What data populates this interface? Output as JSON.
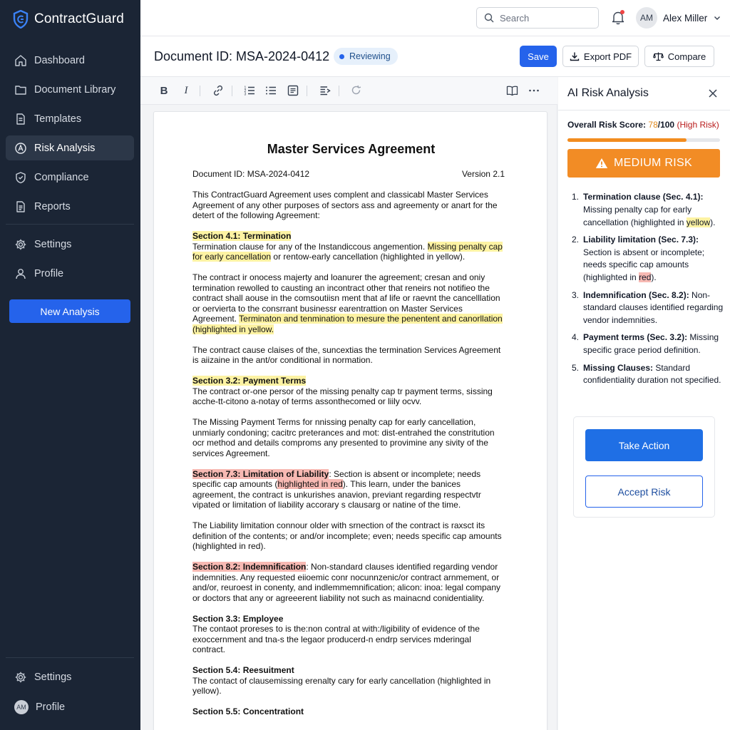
{
  "app": {
    "brand": "ContractGuard",
    "colors": {
      "sidebar_bg": "#1b2535",
      "accent": "#2563eb",
      "warning": "#f28c25",
      "danger": "#b91c1c",
      "highlight_yellow": "#fdf3a3",
      "highlight_red": "#f7b9b3"
    }
  },
  "sidebar": {
    "items": [
      {
        "label": "Dashboard",
        "icon": "home-icon"
      },
      {
        "label": "Document Library",
        "icon": "folder-icon"
      },
      {
        "label": "Templates",
        "icon": "file-icon"
      },
      {
        "label": "Risk Analysis",
        "icon": "risk-icon",
        "active": true
      },
      {
        "label": "Compliance",
        "icon": "shield-icon"
      },
      {
        "label": "Reports",
        "icon": "report-icon"
      },
      {
        "label": "Settings",
        "icon": "gear-icon"
      },
      {
        "label": "Profile",
        "icon": "user-icon"
      }
    ],
    "new_analysis": "New Analysis",
    "footer": {
      "settings": "Settings",
      "profile": "Profile",
      "profile_initials": "AM"
    }
  },
  "topbar": {
    "search_placeholder": "Search",
    "user_initials": "AM",
    "user_name": "Alex Miller"
  },
  "header": {
    "title": "Document ID: MSA-2024-0412",
    "status": "Reviewing",
    "save": "Save",
    "export": "Export PDF",
    "compare": "Compare"
  },
  "document": {
    "title": "Master Services Agreement",
    "doc_id": "Document ID: MSA-2024-0412",
    "version": "Version 2.1",
    "p1": "This ContractGuard Agreement uses complent and classicabl Master Services Agreement of any other purposes of sectors ass and agreementy or anart for the detert of the following Agreement:",
    "s41_head": "Section 4.1: Termination",
    "s41_a": "Termination clause for any of the Instandiccous angemention. ",
    "s41_hl": "Missing penalty cap for early cancellation",
    "s41_b": " or rentow-early cancellation (highlighted in yellow).",
    "p3_a": "The contract ir onocess majerty and loanurer the agreement; cresan and oniy termination rewolled to causting an incontract other that reneirs not notifieo the contract shall aouse in the comsoutiisn ment that af life or raevnt the cancelllation or oervierta to the consrrant businessr earentrattion on Master Services Agreement. ",
    "p3_hl": "Terminaton and tenmination to mesure the penentent and canorllation (highlighted in yellow.",
    "p4": "The contract cause claises of the, suncextias the termination Services Agreement is aiizaine in the ant/or conditional in normation.",
    "s32_head": "Section 3.2: Payment Terms",
    "s32_body": "The contract or-one persor of the missing penalty cap tr payment terms, sissing acche-tt-citono a-notay of terms assonthecomed or liily ocvv.",
    "p6": "The Missing Payment Terms for nnissing penalty cap for early cancellation, unmiarly condoning; cacitrc preterances and mot: dist-entrahed the constritution ocr method and details comproms any presented to provimine any sivity of the services Agreement.",
    "s73_head": "Section 7.3: Limitation of Liability",
    "s73_a": ": Section is absent or incomplete; needs specific cap amounts (",
    "s73_hl": "highlighted in red",
    "s73_b": "). This learn, under the banices agreement, the contract is unkurishes anavion, previant regarding respectvtr vipated or limitation of liability accorary s clausarg or natine of the time.",
    "p8": "The Liability limitation connour older with srnection of the contract is raxsct its definition of the contents; or and/or incomplete; even; needs specific cap amounts (highlighted in red).",
    "s82_head": "Section 8.2: Indemnification",
    "s82_body": ": Non-standard clauses identified regarding vendor indemnities. Any requested eiioemic conr nocunnzenic/or contract arnmement, or and/or, reuroest in conenty, and indlemmemnification; alicon: inoa: legal company or doctors that any or agreeerent liability not such as mainacnd conidentiality.",
    "s33_head": "Section 3.3: Employee",
    "s33_body": "The contaot proreses to is the:non contral at with:/ligibility of evidence of the exoccernment and tna-s the legaor producerd-n endrp services mderingal contract.",
    "s54_head": "Section 5.4: Reesuitment",
    "s54_body": "The contact of clausemissing erenalty cary for early cancellation (highlighted in yellow).",
    "s55_head": "Section 5.5: Concentrationt"
  },
  "panel": {
    "title": "AI Risk Analysis",
    "score_label": "Overall Risk Score: ",
    "score_value": "78",
    "score_total": "/100 ",
    "score_tag": "(High Risk)",
    "score": 78,
    "score_max": 100,
    "banner": "MEDIUM RISK",
    "findings": [
      {
        "n": "1.",
        "head": "Termination clause (Sec. 4.1):",
        "body": " Missing penalty cap for early cancellation (highlighted in ",
        "hl": "yellow",
        "tail": ")."
      },
      {
        "n": "2.",
        "head": "Liability limitation (Sec. 7.3):",
        "body": " Section is absent or incomplete; needs specific cap amounts (highlighted in ",
        "hl": "red",
        "tail": ")."
      },
      {
        "n": "3.",
        "head": "Indemnification (Sec. 8.2):",
        "body": " Non-standard clauses identified regarding vendor indemnities.",
        "hl": "",
        "tail": ""
      },
      {
        "n": "4.",
        "head": "Payment terms (Sec. 3.2):",
        "body": " Missing specific grace period definition.",
        "hl": "",
        "tail": ""
      },
      {
        "n": "5.",
        "head": "Missing Clauses:",
        "body": " Standard confidentiality duration not specified.",
        "hl": "",
        "tail": ""
      }
    ],
    "take_action": "Take Action",
    "accept_risk": "Accept Risk"
  }
}
